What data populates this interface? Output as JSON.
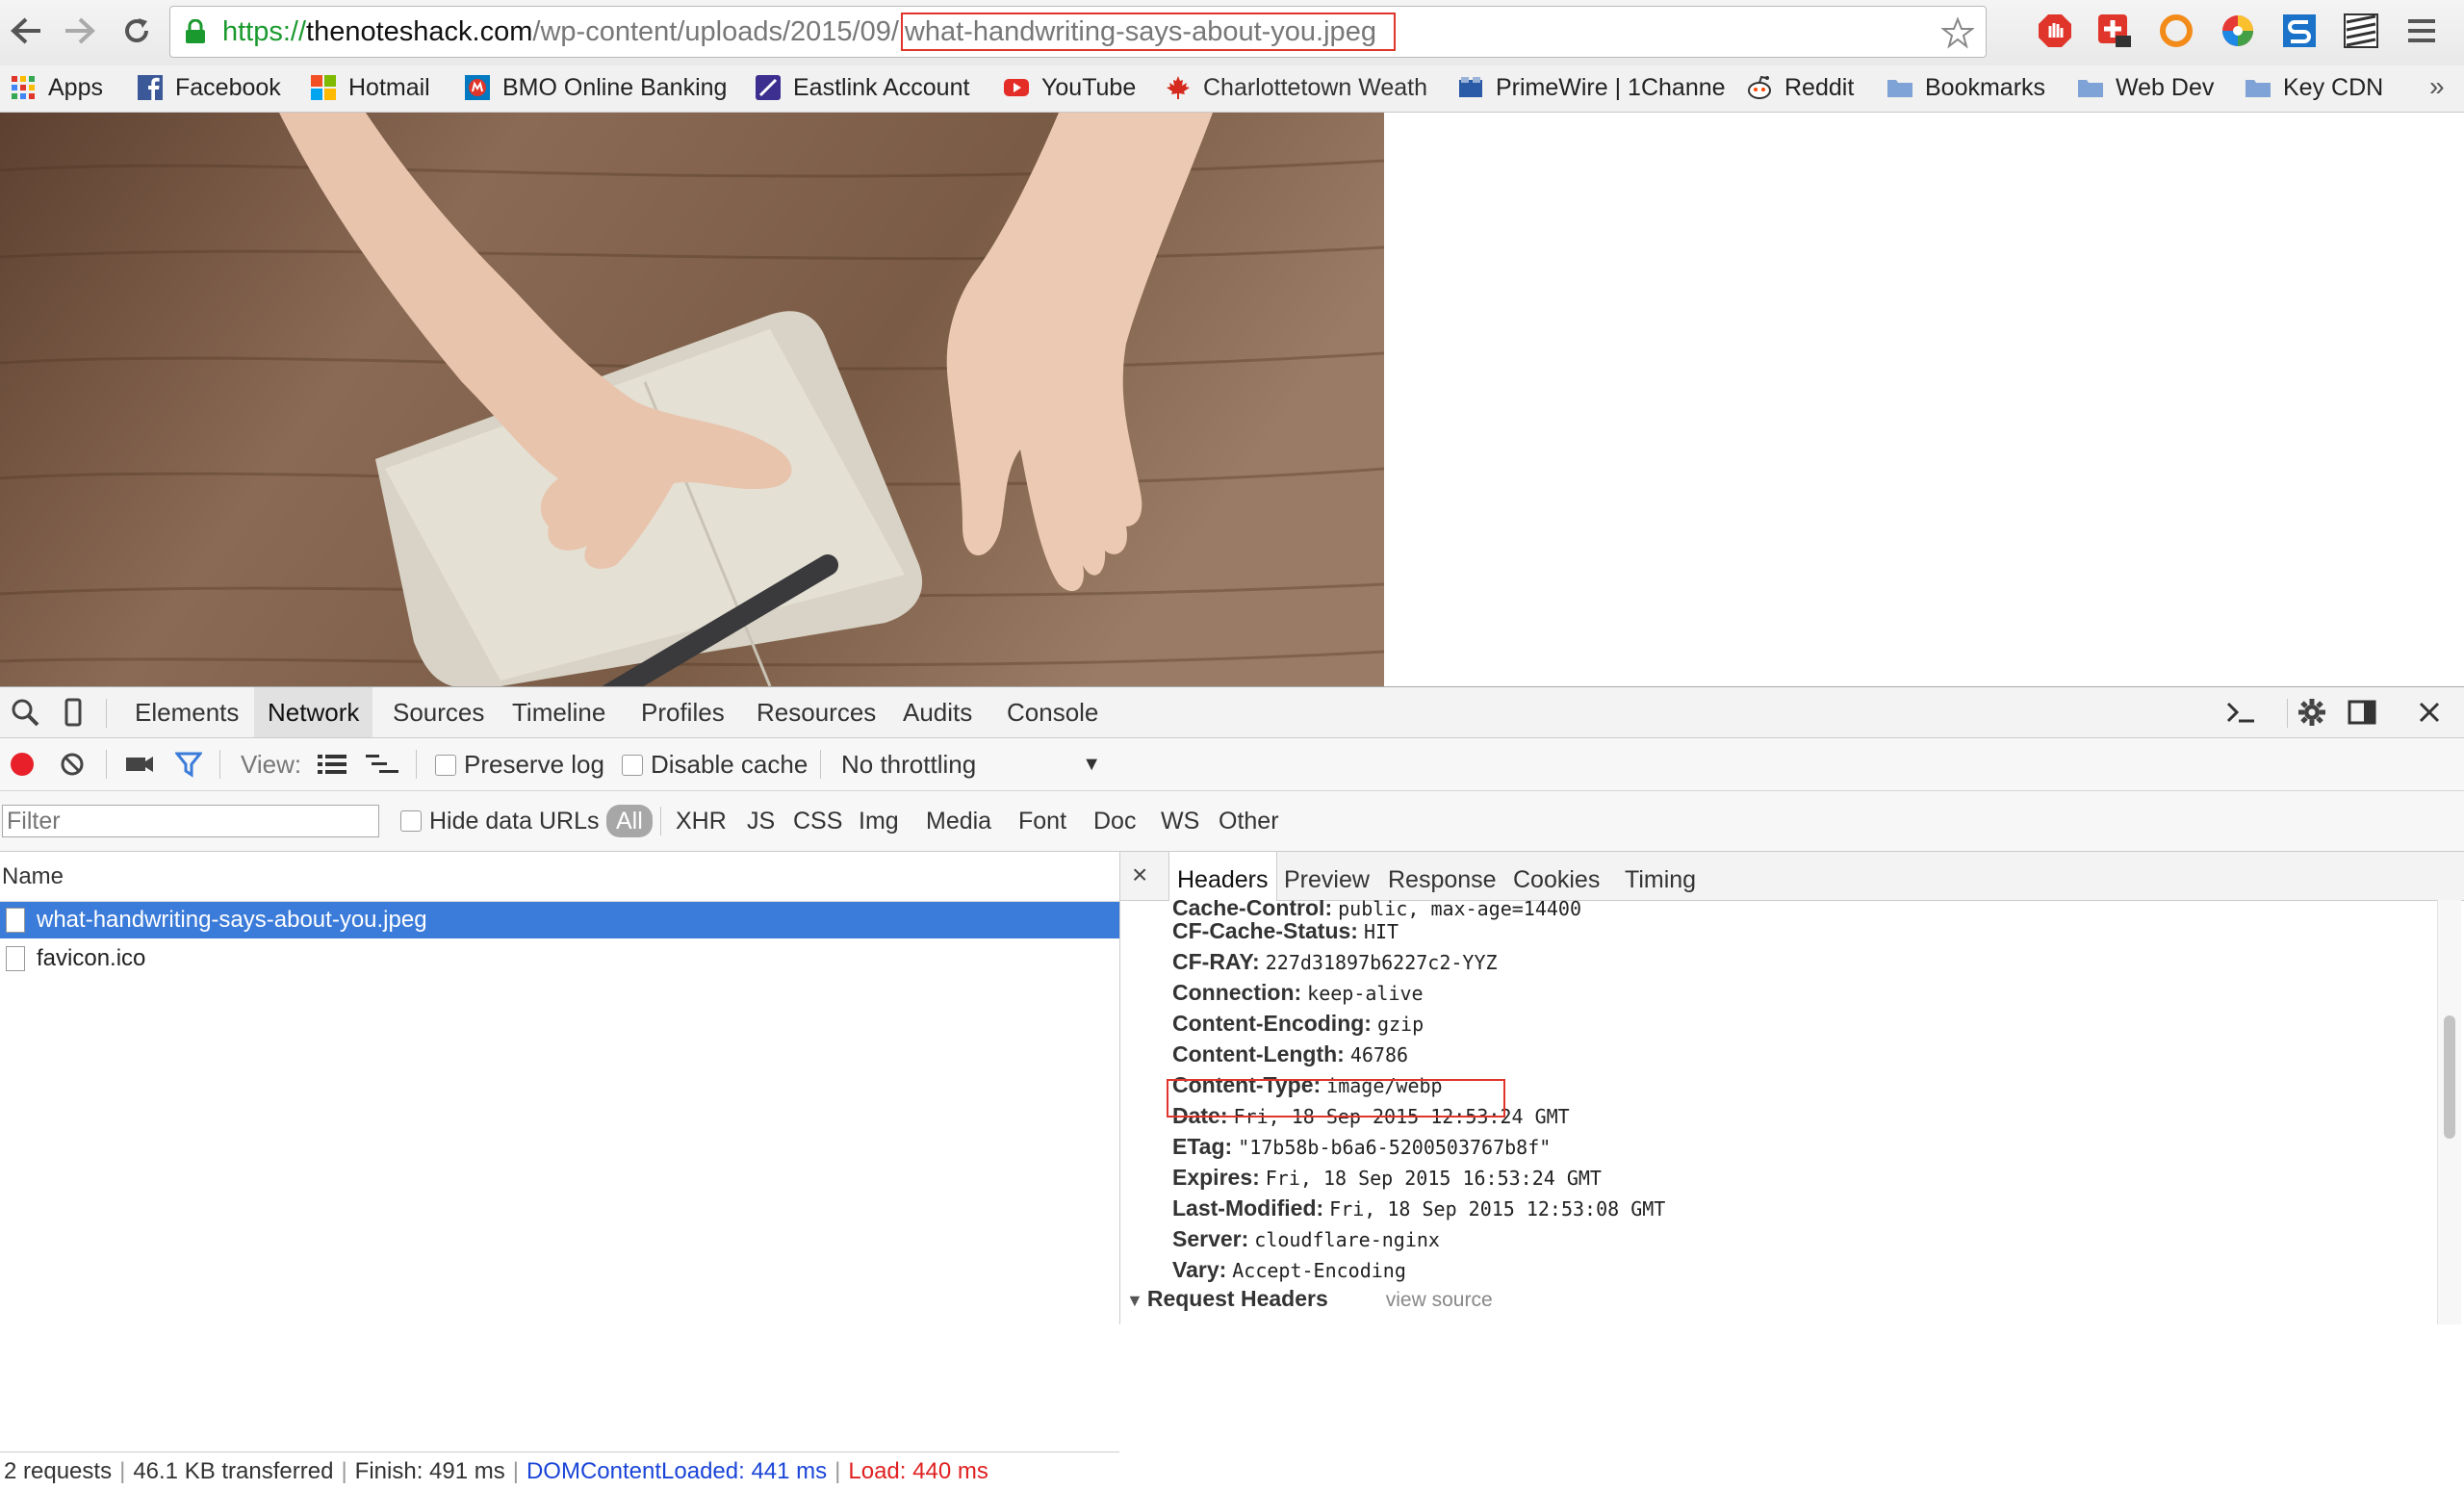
{
  "browser": {
    "url_scheme": "https://",
    "url_host": "thenoteshack.com",
    "url_path": "/wp-content/uploads/2015/09/",
    "url_file": "what-handwriting-says-about-you.jpeg"
  },
  "bookmarks": [
    {
      "label": "Apps",
      "icon": "apps-grid-icon",
      "color": "#e0352b"
    },
    {
      "label": "Facebook",
      "icon": "facebook-icon",
      "color": "#3b5998"
    },
    {
      "label": "Hotmail",
      "icon": "microsoft-icon",
      "color": "#f25022"
    },
    {
      "label": "BMO Online Banking",
      "icon": "bmo-icon",
      "color": "#0079c1"
    },
    {
      "label": "Eastlink Account",
      "icon": "eastlink-icon",
      "color": "#3c2f8f"
    },
    {
      "label": "YouTube",
      "icon": "youtube-icon",
      "color": "#e52d27"
    },
    {
      "label": "Charlottetown Weath",
      "icon": "maple-leaf-icon",
      "color": "#d52b1e"
    },
    {
      "label": "PrimeWire | 1Channe",
      "icon": "primewire-icon",
      "color": "#2b5aa6"
    },
    {
      "label": "Reddit",
      "icon": "reddit-icon",
      "color": "#ff4500"
    },
    {
      "label": "Bookmarks",
      "icon": "folder-icon",
      "color": "#7fa3d6"
    },
    {
      "label": "Web Dev",
      "icon": "folder-icon",
      "color": "#7fa3d6"
    },
    {
      "label": "Key CDN",
      "icon": "folder-icon",
      "color": "#7fa3d6"
    }
  ],
  "devtools": {
    "tabs": [
      "Elements",
      "Network",
      "Sources",
      "Timeline",
      "Profiles",
      "Resources",
      "Audits",
      "Console"
    ],
    "active_tab": "Network",
    "toolbar": {
      "view_label": "View:",
      "preserve_log": "Preserve log",
      "disable_cache": "Disable cache",
      "throttling": "No throttling"
    },
    "filter": {
      "placeholder": "Filter",
      "hide_data_urls": "Hide data URLs",
      "types": [
        "All",
        "XHR",
        "JS",
        "CSS",
        "Img",
        "Media",
        "Font",
        "Doc",
        "WS",
        "Other"
      ]
    },
    "requests": {
      "column_name": "Name",
      "rows": [
        "what-handwriting-says-about-you.jpeg",
        "favicon.ico"
      ]
    },
    "status": {
      "requests": "2 requests",
      "transferred": "46.1 KB transferred",
      "finish": "Finish: 491 ms",
      "dom_content_loaded": "DOMContentLoaded: 441 ms",
      "load": "Load: 440 ms"
    },
    "detail_tabs": [
      "Headers",
      "Preview",
      "Response",
      "Cookies",
      "Timing"
    ],
    "headers": [
      {
        "k": "Cache-Control:",
        "v": "public, max-age=14400"
      },
      {
        "k": "CF-Cache-Status:",
        "v": "HIT"
      },
      {
        "k": "CF-RAY:",
        "v": "227d31897b6227c2-YYZ"
      },
      {
        "k": "Connection:",
        "v": "keep-alive"
      },
      {
        "k": "Content-Encoding:",
        "v": "gzip"
      },
      {
        "k": "Content-Length:",
        "v": "46786"
      },
      {
        "k": "Content-Type:",
        "v": "image/webp"
      },
      {
        "k": "Date:",
        "v": "Fri, 18 Sep 2015 12:53:24 GMT"
      },
      {
        "k": "ETag:",
        "v": "\"17b58b-b6a6-5200503767b8f\""
      },
      {
        "k": "Expires:",
        "v": "Fri, 18 Sep 2015 16:53:24 GMT"
      },
      {
        "k": "Last-Modified:",
        "v": "Fri, 18 Sep 2015 12:53:08 GMT"
      },
      {
        "k": "Server:",
        "v": "cloudflare-nginx"
      },
      {
        "k": "Vary:",
        "v": "Accept-Encoding"
      }
    ],
    "request_headers_label": "Request Headers",
    "view_source_label": "view source"
  }
}
